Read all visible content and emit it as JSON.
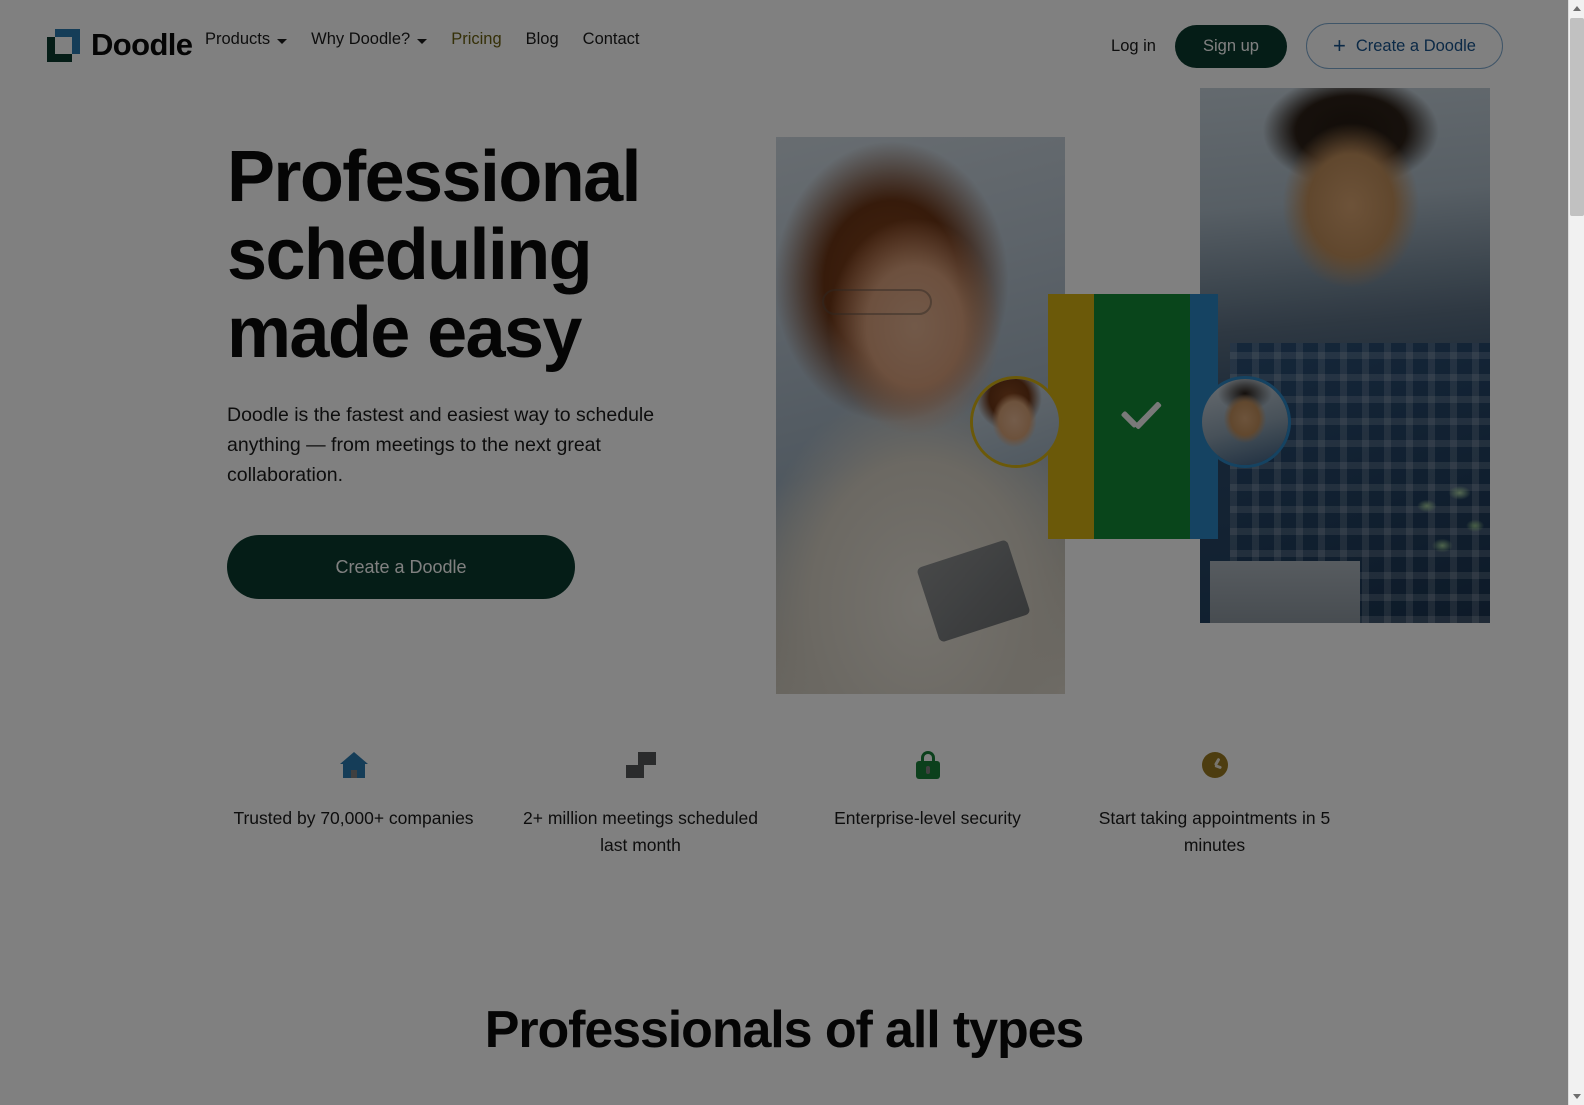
{
  "header": {
    "logo_text": "Doodle",
    "logo_icon": "doodle-squares-logo",
    "nav": [
      {
        "label": "Products",
        "has_caret": true,
        "state": "default"
      },
      {
        "label": "Why Doodle?",
        "has_caret": true,
        "state": "default"
      },
      {
        "label": "Pricing",
        "has_caret": false,
        "state": "hovered"
      },
      {
        "label": "Blog",
        "has_caret": false,
        "state": "default"
      },
      {
        "label": "Contact",
        "has_caret": false,
        "state": "default"
      }
    ],
    "login_label": "Log in",
    "signup_label": "Sign up",
    "create_doodle_label": "Create a Doodle",
    "create_doodle_icon": "plus-icon"
  },
  "hero": {
    "title": "Professional scheduling made easy",
    "subtitle": "Doodle is the fastest and easiest way to schedule anything — from meetings to the next great collaboration.",
    "cta_label": "Create a Doodle",
    "collage": {
      "left_photo_alt": "woman-with-glasses-holding-tablet",
      "right_photo_alt": "man-in-plaid-shirt-at-laptop",
      "check_icon": "checkmark-icon",
      "avatar_left_alt": "avatar-woman",
      "avatar_right_alt": "avatar-man"
    }
  },
  "trust_bar": [
    {
      "icon": "home-icon",
      "label": "Trusted by 70,000+ companies"
    },
    {
      "icon": "overlapping-squares-icon",
      "label": "2+ million meetings scheduled last month"
    },
    {
      "icon": "lock-icon",
      "label": "Enterprise-level security"
    },
    {
      "icon": "clock-icon",
      "label": "Start taking appointments in 5 minutes"
    }
  ],
  "section_2": {
    "title": "Professionals of all types"
  },
  "colors": {
    "brand_green": "#0b3b2e",
    "brand_blue": "#2b7bb0",
    "accent_yellow": "#d6b113",
    "accent_green": "#138a36",
    "accent_gold": "#9a7a20",
    "link_blue": "#17528c",
    "text_dark": "#0b0b0b",
    "overlay": "rgba(0,0,0,0.5)"
  },
  "scrollbar": {
    "up_arrow": "scroll-up-arrow",
    "down_arrow": "scroll-down-arrow"
  }
}
